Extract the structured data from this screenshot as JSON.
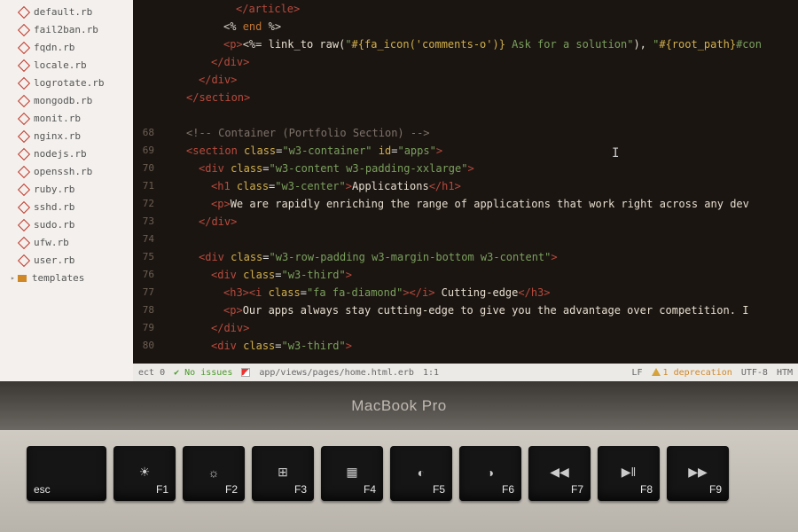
{
  "sidebar": {
    "files": [
      "default.rb",
      "fail2ban.rb",
      "fqdn.rb",
      "locale.rb",
      "logrotate.rb",
      "mongodb.rb",
      "monit.rb",
      "nginx.rb",
      "nodejs.rb",
      "openssh.rb",
      "ruby.rb",
      "sshd.rb",
      "sudo.rb",
      "ufw.rb",
      "user.rb"
    ],
    "folder": "templates"
  },
  "editor": {
    "gutter_start_visible": 68,
    "gutter": [
      "",
      "",
      "",
      "",
      "",
      "",
      "",
      "68",
      "69",
      "70",
      "71",
      "72",
      "73",
      "74",
      "75",
      "76",
      "77",
      "78",
      "79",
      "80"
    ],
    "lines": {
      "l0": {
        "ind": 6,
        "html": "<span class='tag'>&lt;/article&gt;</span>"
      },
      "l1": {
        "ind": 5,
        "html": "<span class='erb'>&lt;%</span> <span class='kw'>end</span> <span class='erb'>%&gt;</span>"
      },
      "l2": {
        "ind": 5,
        "html": "<span class='tag'>&lt;p&gt;</span><span class='erb'>&lt;%=</span> <span class='txt'>link_to raw(</span><span class='str'>\"</span><span class='interp'>#{fa_icon('comments-o')}</span><span class='str'> Ask for a solution\"</span><span class='txt'>), </span><span class='str'>\"</span><span class='interp'>#{root_path}</span><span class='str'>#con</span>"
      },
      "l3": {
        "ind": 4,
        "html": "<span class='tag'>&lt;/div&gt;</span>"
      },
      "l4": {
        "ind": 3,
        "html": "<span class='tag'>&lt;/div&gt;</span>"
      },
      "l5": {
        "ind": 2,
        "html": "<span class='tag'>&lt;/section&gt;</span>"
      },
      "l6": {
        "ind": 0,
        "html": ""
      },
      "l7": {
        "ind": 2,
        "html": "<span class='cmt'>&lt;!-- Container (Portfolio Section) --&gt;</span>"
      },
      "l8": {
        "ind": 2,
        "html": "<span class='tag'>&lt;section</span> <span class='attr'>class</span>=<span class='str'>\"w3-container\"</span> <span class='attr'>id</span>=<span class='str'>\"apps\"</span><span class='tag'>&gt;</span>"
      },
      "l9": {
        "ind": 3,
        "html": "<span class='tag'>&lt;div</span> <span class='attr'>class</span>=<span class='str'>\"w3-content w3-padding-xxlarge\"</span><span class='tag'>&gt;</span>"
      },
      "l10": {
        "ind": 4,
        "html": "<span class='tag'>&lt;h1</span> <span class='attr'>class</span>=<span class='str'>\"w3-center\"</span><span class='tag'>&gt;</span><span class='txt'>Applications</span><span class='tag'>&lt;/h1&gt;</span>"
      },
      "l11": {
        "ind": 4,
        "html": "<span class='tag'>&lt;p&gt;</span><span class='txt'>We are rapidly enriching the range of applications that work right across any dev</span>"
      },
      "l12": {
        "ind": 3,
        "html": "<span class='tag'>&lt;/div&gt;</span>"
      },
      "l13": {
        "ind": 0,
        "html": ""
      },
      "l14": {
        "ind": 3,
        "html": "<span class='tag'>&lt;div</span> <span class='attr'>class</span>=<span class='str'>\"w3-row-padding w3-margin-bottom w3-content\"</span><span class='tag'>&gt;</span>"
      },
      "l15": {
        "ind": 4,
        "html": "<span class='tag'>&lt;div</span> <span class='attr'>class</span>=<span class='str'>\"w3-third\"</span><span class='tag'>&gt;</span>"
      },
      "l16": {
        "ind": 5,
        "html": "<span class='tag'>&lt;h3&gt;&lt;i</span> <span class='attr'>class</span>=<span class='str'>\"fa fa-diamond\"</span><span class='tag'>&gt;&lt;/i&gt;</span><span class='txt'> Cutting-edge</span><span class='tag'>&lt;/h3&gt;</span>"
      },
      "l17": {
        "ind": 5,
        "html": "<span class='tag'>&lt;p&gt;</span><span class='txt'>Our apps always stay cutting-edge to give you the advantage over competition. I</span>"
      },
      "l18": {
        "ind": 4,
        "html": "<span class='tag'>&lt;/div&gt;</span>"
      },
      "l19": {
        "ind": 4,
        "html": "<span class='tag'>&lt;div</span> <span class='attr'>class</span>=<span class='str'>\"w3-third\"</span><span class='tag'>&gt;</span>"
      }
    }
  },
  "status": {
    "left_project": "ect 0",
    "no_issues": "No issues",
    "filepath": "app/views/pages/home.html.erb",
    "position": "1:1",
    "line_ending": "LF",
    "deprecation": "1 deprecation",
    "encoding": "UTF-8",
    "syntax": "HTM"
  },
  "laptop": {
    "brand": "MacBook Pro",
    "keys": [
      {
        "sym": "",
        "lab": "esc"
      },
      {
        "sym": "☀",
        "lab": "F1"
      },
      {
        "sym": "☼",
        "lab": "F2"
      },
      {
        "sym": "⊞",
        "lab": "F3"
      },
      {
        "sym": "▦",
        "lab": "F4"
      },
      {
        "sym": "◐",
        "lab": "F5"
      },
      {
        "sym": "◑",
        "lab": "F6"
      },
      {
        "sym": "◀◀",
        "lab": "F7"
      },
      {
        "sym": "▶‖",
        "lab": "F8"
      },
      {
        "sym": "▶▶",
        "lab": "F9"
      }
    ]
  }
}
